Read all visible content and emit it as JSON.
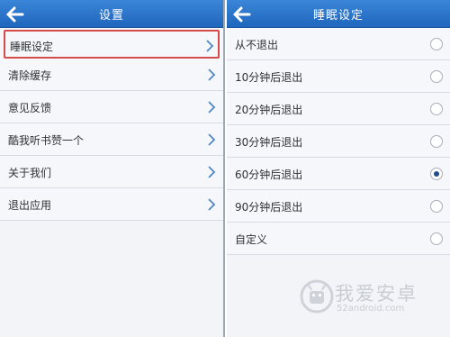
{
  "left_screen": {
    "title": "设置",
    "items": [
      {
        "label": "睡眠设定",
        "highlighted": true
      },
      {
        "label": "清除缓存"
      },
      {
        "label": "意见反馈"
      },
      {
        "label": "酷我听书赞一个"
      },
      {
        "label": "关于我们"
      },
      {
        "label": "退出应用"
      }
    ]
  },
  "right_screen": {
    "title": "睡眠设定",
    "options": [
      {
        "label": "从不退出",
        "checked": false
      },
      {
        "label": "10分钟后退出",
        "checked": false
      },
      {
        "label": "20分钟后退出",
        "checked": false
      },
      {
        "label": "30分钟后退出",
        "checked": false
      },
      {
        "label": "60分钟后退出",
        "checked": true
      },
      {
        "label": "90分钟后退出",
        "checked": false
      },
      {
        "label": "自定义",
        "checked": false
      }
    ]
  },
  "watermark": {
    "brand_cn": "我爱安卓",
    "brand_en": "52android.com"
  },
  "colors": {
    "header": "#1f66bd",
    "highlight_border": "#d64b4b",
    "radio_dot": "#1f4f8c"
  }
}
